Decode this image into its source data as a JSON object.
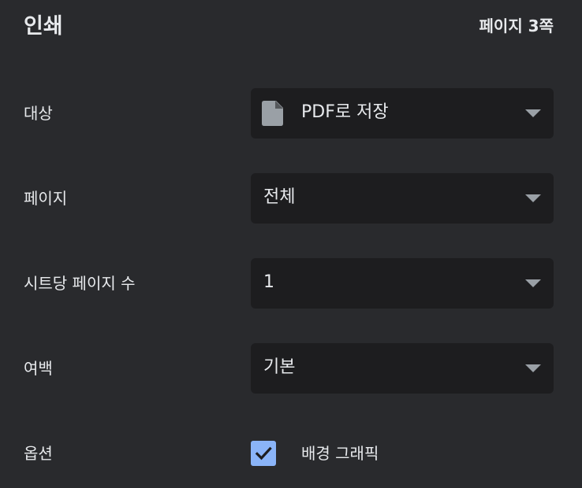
{
  "header": {
    "title": "인쇄",
    "page_count": "페이지 3쪽"
  },
  "settings": {
    "destination": {
      "label": "대상",
      "value": "PDF로 저장",
      "icon": "document-icon"
    },
    "pages": {
      "label": "페이지",
      "value": "전체"
    },
    "pages_per_sheet": {
      "label": "시트당 페이지 수",
      "value": "1"
    },
    "margins": {
      "label": "여백",
      "value": "기본"
    },
    "options": {
      "label": "옵션",
      "checkbox_label": "배경 그래픽",
      "checked": true
    }
  },
  "colors": {
    "background": "#292a2d",
    "select_background": "#1d1d1f",
    "text": "#e8eaed",
    "chevron": "#9aa0a6",
    "checkbox_accent": "#8ab4f8"
  }
}
